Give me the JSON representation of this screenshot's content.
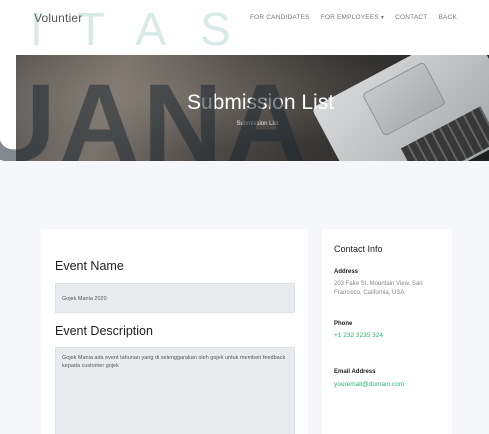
{
  "navbar": {
    "brand": "Voluntier",
    "links": [
      {
        "label": "FOR CANDIDATES"
      },
      {
        "label": "FOR EMPLOYEES"
      },
      {
        "label": "CONTACT"
      },
      {
        "label": "BACK"
      }
    ],
    "dropdown_caret": "▾"
  },
  "watermark": {
    "top": "ITAS",
    "big": "UANA"
  },
  "hero": {
    "title": "Submission List",
    "breadcrumb": "Submission List"
  },
  "form": {
    "event_name_label": "Event Name",
    "event_name_value": "Gojek Mania 2020",
    "event_description_label": "Event Description",
    "event_description_value": "Gojek Mania ada event tahunan yang di selenggarakan oleh gojek untuk memberi feedback kepada customer gojek"
  },
  "contact": {
    "title": "Contact Info",
    "address_label": "Address",
    "address_value": "203 Fake St. Mountain View, San Francisco, California, USA",
    "phone_label": "Phone",
    "phone_value": "+1 232 3235 324",
    "email_label": "Email Address",
    "email_value": "youremail@domain.com"
  },
  "colors": {
    "accent": "#2bb673",
    "page_bg": "#f5f7fb",
    "input_bg": "#e9ecef"
  }
}
